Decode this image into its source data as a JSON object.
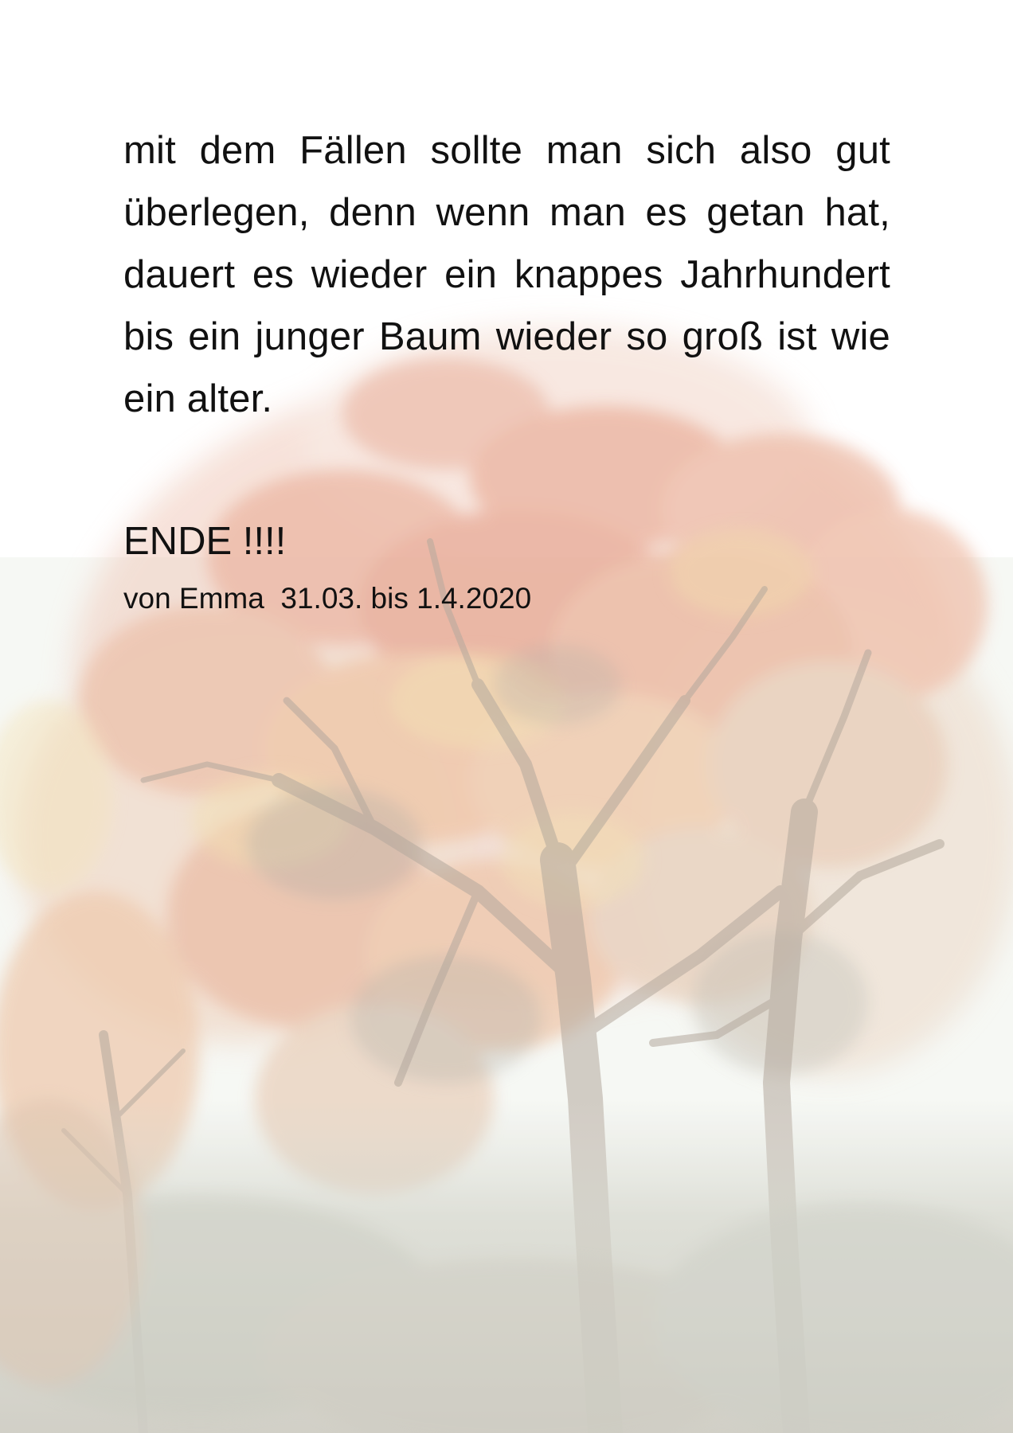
{
  "document": {
    "paragraph": "mit dem Fällen sollte man sich also gut überlegen, denn wenn man es getan hat, dauert es wieder ein knappes Jahrhundert bis ein junger Baum wieder so groß ist wie ein alter.",
    "ending": "ENDE !!!!",
    "signature": "von Emma  31.03. bis 1.4.2020"
  },
  "background": {
    "image": "faded-autumn-tree",
    "colors": {
      "foliage_red": "#e7a38e",
      "foliage_orange": "#edbd8f",
      "foliage_yellow": "#eed9a6",
      "branches": "#a99b8c",
      "undergrowth": "#c4c8bc",
      "sky": "#f4f6f2"
    }
  }
}
